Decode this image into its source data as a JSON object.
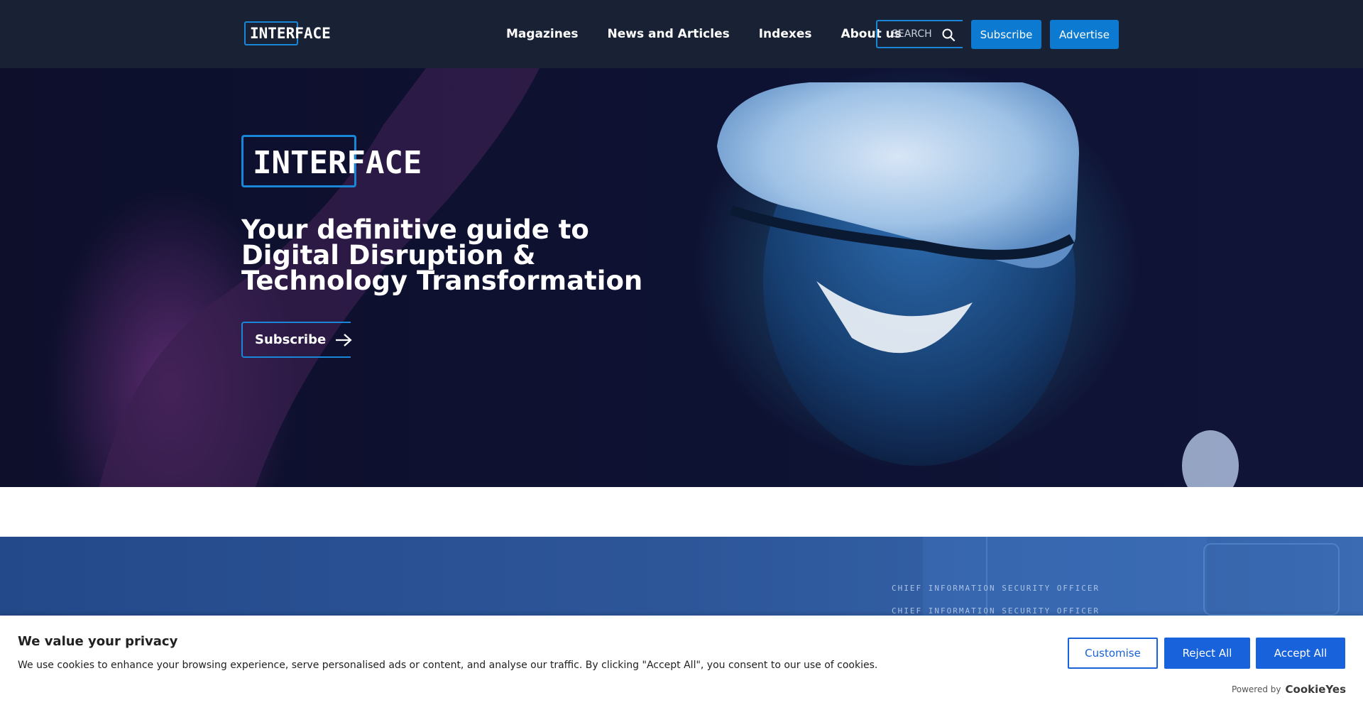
{
  "header": {
    "logo_text": "INTERFACE",
    "nav": [
      "Magazines",
      "News and Articles",
      "Indexes",
      "About us"
    ],
    "search_placeholder": "SEARCH",
    "subscribe_label": "Subscribe",
    "advertise_label": "Advertise"
  },
  "hero": {
    "logo_text": "INTERFACE",
    "title": "Your definitive guide to Digital Disruption & Technology Transformation",
    "subscribe_label": "Subscribe"
  },
  "blue_section": {
    "lines": [
      "CHIEF INFORMATION SECURITY OFFICER",
      "CHIEF INFORMATION SECURITY OFFICER"
    ]
  },
  "cookie": {
    "title": "We value your privacy",
    "text": "We use cookies to enhance your browsing experience, serve personalised ads or content, and analyse our traffic. By clicking \"Accept All\", you consent to our use of cookies.",
    "customise_label": "Customise",
    "reject_label": "Reject All",
    "accept_label": "Accept All",
    "powered_by": "Powered by",
    "brand": "CookieYes"
  },
  "colors": {
    "header_bg": "#182234",
    "accent": "#1a86d8",
    "button_blue": "#0b7ad0",
    "cookie_blue": "#1863dc"
  }
}
